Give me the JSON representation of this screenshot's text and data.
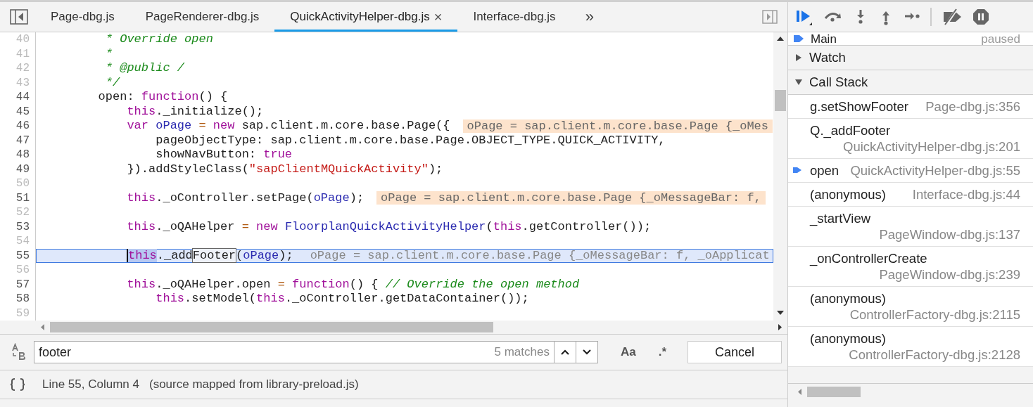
{
  "editor_tabs": [
    {
      "label": "Page-dbg.js",
      "selected": false
    },
    {
      "label": "PageRenderer-dbg.js",
      "selected": false
    },
    {
      "label": "QuickActivityHelper-dbg.js",
      "selected": true,
      "close": "×"
    },
    {
      "label": "Interface-dbg.js",
      "selected": false
    }
  ],
  "tabs_overflow": "»",
  "code": {
    "lines": [
      {
        "number": "40",
        "breakable": false,
        "tokens": [
          {
            "kind": "comment",
            "text": "         * Override open"
          }
        ]
      },
      {
        "number": "41",
        "breakable": false,
        "tokens": [
          {
            "kind": "comment",
            "text": "         *"
          }
        ]
      },
      {
        "number": "42",
        "breakable": false,
        "tokens": [
          {
            "kind": "comment",
            "text": "         * @public /"
          }
        ]
      },
      {
        "number": "43",
        "breakable": false,
        "tokens": [
          {
            "kind": "comment",
            "text": "         */"
          }
        ]
      },
      {
        "number": "44",
        "breakable": true,
        "tokens": [
          {
            "kind": "plain",
            "text": "        open: "
          },
          {
            "kind": "keyword",
            "text": "function"
          },
          {
            "kind": "plain",
            "text": "() {"
          }
        ]
      },
      {
        "number": "45",
        "breakable": true,
        "tokens": [
          {
            "kind": "keyword",
            "text": "            this"
          },
          {
            "kind": "plain",
            "text": "._initialize();"
          }
        ]
      },
      {
        "number": "46",
        "breakable": true,
        "tokens": [
          {
            "kind": "keyword",
            "text": "            var "
          },
          {
            "kind": "variable",
            "text": "oPage "
          },
          {
            "kind": "operator",
            "text": "= "
          },
          {
            "kind": "keyword",
            "text": "new"
          },
          {
            "kind": "plain",
            "text": " sap.client.m.core.base.Page({"
          }
        ],
        "inline_value": "oPage = sap.client.m.core.base.Page {_oMes"
      },
      {
        "number": "47",
        "breakable": true,
        "tokens": [
          {
            "kind": "plain",
            "text": "                pageObjectType: sap.client.m.core.base.Page.OBJECT_TYPE.QUICK_ACTIVITY,"
          }
        ]
      },
      {
        "number": "48",
        "breakable": true,
        "tokens": [
          {
            "kind": "plain",
            "text": "                showNavButton: "
          },
          {
            "kind": "keyword",
            "text": "true"
          }
        ]
      },
      {
        "number": "49",
        "breakable": true,
        "tokens": [
          {
            "kind": "plain",
            "text": "            }).addStyleClass("
          },
          {
            "kind": "string",
            "text": "\"sapClientMQuickActivity\""
          },
          {
            "kind": "plain",
            "text": ");"
          }
        ]
      },
      {
        "number": "50",
        "breakable": false
      },
      {
        "number": "51",
        "breakable": true,
        "tokens": [
          {
            "kind": "keyword",
            "text": "            this"
          },
          {
            "kind": "plain",
            "text": "._oController.setPage("
          },
          {
            "kind": "variable",
            "text": "oPage"
          },
          {
            "kind": "plain",
            "text": ");"
          }
        ],
        "inline_value": "oPage = sap.client.m.core.base.Page {_oMessageBar: f,"
      },
      {
        "number": "52",
        "breakable": false
      },
      {
        "number": "53",
        "breakable": true,
        "tokens": [
          {
            "kind": "keyword",
            "text": "            this"
          },
          {
            "kind": "plain",
            "text": "._oQAHelper "
          },
          {
            "kind": "operator",
            "text": "= "
          },
          {
            "kind": "keyword",
            "text": "new "
          },
          {
            "kind": "variable",
            "text": "FloorplanQuickActivityHelper"
          },
          {
            "kind": "plain",
            "text": "("
          },
          {
            "kind": "keyword",
            "text": "this"
          },
          {
            "kind": "plain",
            "text": ".getController());"
          }
        ]
      },
      {
        "number": "54",
        "breakable": false
      },
      {
        "number": "55",
        "breakable": true,
        "current": true,
        "tokens": [
          {
            "kind": "selection",
            "text": "this"
          },
          {
            "kind": "plain",
            "text": "._add"
          },
          {
            "kind": "match",
            "text": "Footer"
          },
          {
            "kind": "plain",
            "text": "("
          },
          {
            "kind": "variable",
            "text": "oPage"
          },
          {
            "kind": "plain",
            "text": ");"
          }
        ],
        "inline_value": "oPage = sap.client.m.core.base.Page {_oMessageBar: f, _oApplicat"
      },
      {
        "number": "56",
        "breakable": false
      },
      {
        "number": "57",
        "breakable": true,
        "tokens": [
          {
            "kind": "keyword",
            "text": "            this"
          },
          {
            "kind": "plain",
            "text": "._oQAHelper.open "
          },
          {
            "kind": "operator",
            "text": "= "
          },
          {
            "kind": "keyword",
            "text": "function"
          },
          {
            "kind": "plain",
            "text": "() { "
          },
          {
            "kind": "comment",
            "text": "// Override the open method"
          }
        ]
      },
      {
        "number": "58",
        "breakable": true,
        "tokens": [
          {
            "kind": "keyword",
            "text": "                this"
          },
          {
            "kind": "plain",
            "text": ".setModel("
          },
          {
            "kind": "keyword",
            "text": "this"
          },
          {
            "kind": "plain",
            "text": "._oController.getDataContainer());"
          }
        ]
      },
      {
        "number": "59",
        "breakable": false
      }
    ]
  },
  "search": {
    "value": "footer",
    "matches": "5 matches",
    "case_toggle": "Aa",
    "regex_toggle": ".*",
    "cancel": "Cancel"
  },
  "status_bar": {
    "position": "Line 55, Column 4",
    "source_map": "(source mapped from library-preload.js)"
  },
  "threads": {
    "name": "Main",
    "state": "paused"
  },
  "sections": [
    {
      "title": "Watch",
      "expanded": false
    },
    {
      "title": "Call Stack",
      "expanded": true
    }
  ],
  "call_stack": [
    {
      "function": "g.setShowFooter",
      "location": "Page-dbg.js:356",
      "current": false
    },
    {
      "function": "Q._addFooter",
      "location": "QuickActivityHelper-dbg.js:201",
      "current": false
    },
    {
      "function": "open",
      "location": "QuickActivityHelper-dbg.js:55",
      "current": true
    },
    {
      "function": "(anonymous)",
      "location": "Interface-dbg.js:44",
      "current": false
    },
    {
      "function": "_startView",
      "location": "PageWindow-dbg.js:137",
      "current": false
    },
    {
      "function": "_onControllerCreate",
      "location": "PageWindow-dbg.js:239",
      "current": false
    },
    {
      "function": "(anonymous)",
      "location": "ControllerFactory-dbg.js:2115",
      "current": false
    },
    {
      "function": "(anonymous)",
      "location": "ControllerFactory-dbg.js:2128",
      "current": false
    }
  ]
}
